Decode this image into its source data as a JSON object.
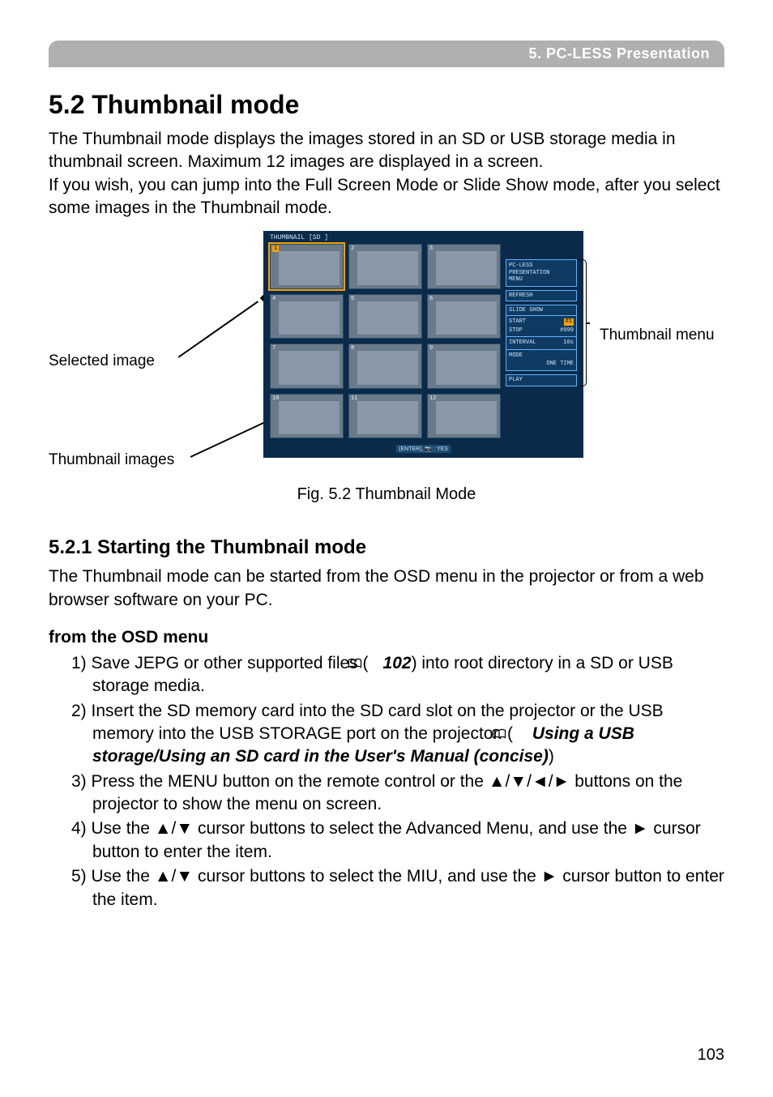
{
  "header": {
    "breadcrumb": "5. PC-LESS Presentation"
  },
  "section": {
    "title": "5.2 Thumbnail mode",
    "intro": "The Thumbnail mode displays the images stored in an SD or USB storage media in thumbnail screen.  Maximum 12 images are displayed in a screen.\nIf you wish, you can jump into the Full Screen Mode or Slide Show mode, after you select some images in the Thumbnail mode."
  },
  "figure": {
    "screen_title": "THUMBNAIL  [SD ]",
    "thumb_numbers": [
      "1",
      "2",
      "3",
      "4",
      "5",
      "6",
      "7",
      "8",
      "9",
      "10",
      "11",
      "12"
    ],
    "selected_index": 0,
    "callout_selected": "Selected image",
    "callout_thumbs": "Thumbnail images",
    "callout_menu": "Thumbnail menu",
    "menu": {
      "block1_l1": "PC-LESS",
      "block1_l2": "PRESENTATION",
      "block1_l3": "MENU",
      "refresh": "REFRESH",
      "slideshow": "SLIDE SHOW",
      "start_k": "START",
      "start_v": "#1",
      "start_hl": true,
      "stop_k": "STOP",
      "stop_v": "#999",
      "interval_k": "INTERVAL",
      "interval_v": "10s",
      "mode_k": "MODE",
      "mode_v": "ONE TIME",
      "play": "PLAY"
    },
    "bottom_note": "(ENTER),  📷 : YES",
    "caption": "Fig. 5.2 Thumbnail Mode"
  },
  "subsection": {
    "title": "5.2.1 Starting the Thumbnail mode",
    "intro": "The Thumbnail mode can be started from the OSD menu in the projector or from a web browser software on your PC.",
    "method_heading": "from the OSD menu",
    "steps": {
      "s1_a": "Save JEPG or other supported files (",
      "s1_ref": "102",
      "s1_b": ") into root directory in a SD or USB storage media.",
      "s2_a": "Insert the SD memory card into the SD card slot on the projector or the USB memory into the USB STORAGE port on the projector. (",
      "s2_ref": "Using a USB storage/Using an SD card in the User's Manual (concise)",
      "s2_b": ")",
      "s3": "Press the MENU button on the remote control or the ▲/▼/◄/► buttons on the projector to show the menu on screen.",
      "s4": "Use the ▲/▼ cursor buttons to select the Advanced Menu, and use the ► cursor button to enter the item.",
      "s5": "Use the ▲/▼ cursor buttons to select the MIU, and use the ► cursor button to enter the item."
    }
  },
  "page_number": "103"
}
